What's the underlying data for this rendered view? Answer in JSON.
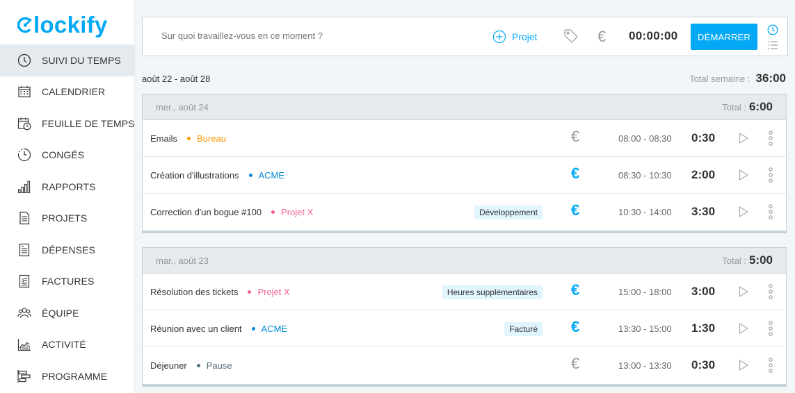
{
  "app": {
    "logo_text": "lockify",
    "brand_color": "#03a9f4"
  },
  "sidebar": {
    "items": [
      {
        "label": "SUIVI DU TEMPS",
        "icon": "clock-icon",
        "active": true
      },
      {
        "label": "CALENDRIER",
        "icon": "calendar-icon"
      },
      {
        "label": "FEUILLE DE TEMPS",
        "icon": "timesheet-icon"
      },
      {
        "label": "CONGÉS",
        "icon": "time-off-icon"
      },
      {
        "label": "RAPPORTS",
        "icon": "reports-icon"
      },
      {
        "label": "PROJETS",
        "icon": "projects-icon"
      },
      {
        "label": "DÉPENSES",
        "icon": "expenses-icon"
      },
      {
        "label": "FACTURES",
        "icon": "invoices-icon"
      },
      {
        "label": "ÉQUIPE",
        "icon": "team-icon"
      },
      {
        "label": "ACTIVITÉ",
        "icon": "activity-icon"
      },
      {
        "label": "PROGRAMME",
        "icon": "schedule-icon"
      }
    ]
  },
  "timer": {
    "placeholder": "Sur quoi travaillez-vous en ce moment ?",
    "project_label": "Projet",
    "currency_symbol": "€",
    "clock": "00:00:00",
    "start_label": "DÉMARRER"
  },
  "week": {
    "range": "août 22 - août 28",
    "total_label": "Total semaine :",
    "total_value": "36:00"
  },
  "days": [
    {
      "date": "mer., août 24",
      "total_label": "Total :",
      "total_value": "6:00",
      "entries": [
        {
          "description": "Emails",
          "project": "Bureau",
          "project_color": "#ff9800",
          "tag": "",
          "billable": false,
          "range": "08:00 - 08:30",
          "duration": "0:30"
        },
        {
          "description": "Création d'illustrations",
          "project": "ACME",
          "project_color": "#0288d1",
          "tag": "",
          "billable": true,
          "range": "08:30 - 10:30",
          "duration": "2:00"
        },
        {
          "description": "Correction d'un bogue #100",
          "project": "Projet X",
          "project_color": "#f06292",
          "tag": "Développement",
          "billable": true,
          "range": "10:30 - 14:00",
          "duration": "3:30"
        }
      ]
    },
    {
      "date": "mar., août 23",
      "total_label": "Total :",
      "total_value": "5:00",
      "entries": [
        {
          "description": "Résolution des tickets",
          "project": "Projet X",
          "project_color": "#f06292",
          "tag": "Heures supplémentaires",
          "billable": true,
          "range": "15:00 - 18:00",
          "duration": "3:00"
        },
        {
          "description": "Réunion avec un client",
          "project": "ACME",
          "project_color": "#0288d1",
          "tag": "Facturé",
          "billable": true,
          "range": "13:30 - 15:00",
          "duration": "1:30"
        },
        {
          "description": "Déjeuner",
          "project": "Pause",
          "project_color": "#546e7a",
          "tag": "",
          "billable": false,
          "range": "13:00 - 13:30",
          "duration": "0:30"
        }
      ]
    }
  ]
}
